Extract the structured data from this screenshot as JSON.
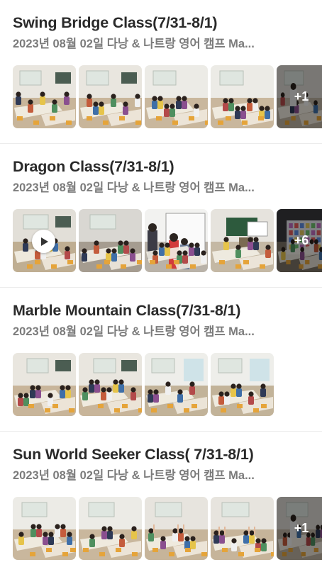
{
  "posts": [
    {
      "title": "Swing Bridge Class(7/31-8/1)",
      "subtitle": "2023년 08월 02일 다낭 & 나트랑 영어 캠프 Ma...",
      "photos": [
        {
          "scene": "classroom-tables",
          "overlay": ""
        },
        {
          "scene": "classroom-tables",
          "overlay": ""
        },
        {
          "scene": "classroom-long",
          "overlay": ""
        },
        {
          "scene": "classroom-long",
          "overlay": ""
        },
        {
          "scene": "teacher-desk",
          "overlay": "+1"
        }
      ]
    },
    {
      "title": "Dragon Class(7/31-8/1)",
      "subtitle": "2023년 08월 02일 다낭 & 나트랑 영어 캠프 Ma...",
      "photos": [
        {
          "scene": "video-classroom",
          "overlay": "",
          "video": true
        },
        {
          "scene": "kids-standing",
          "overlay": ""
        },
        {
          "scene": "whiteboard-kids",
          "overlay": ""
        },
        {
          "scene": "projector-room",
          "overlay": ""
        },
        {
          "scene": "projector-screen",
          "overlay": "+6"
        }
      ]
    },
    {
      "title": "Marble Mountain Class(7/31-8/1)",
      "subtitle": "2023년 08월 02일 다낭 & 나트랑 영어 캠프 Ma...",
      "photos": [
        {
          "scene": "classroom-tables",
          "overlay": ""
        },
        {
          "scene": "classroom-tables",
          "overlay": ""
        },
        {
          "scene": "classroom-window",
          "overlay": ""
        },
        {
          "scene": "classroom-window",
          "overlay": ""
        }
      ]
    },
    {
      "title": "Sun World Seeker Class( 7/31-8/1)",
      "subtitle": "2023년 08월 02일 다낭 & 나트랑 영어 캠프 Ma...",
      "photos": [
        {
          "scene": "classroom-long",
          "overlay": ""
        },
        {
          "scene": "classroom-long",
          "overlay": ""
        },
        {
          "scene": "kids-raising",
          "overlay": ""
        },
        {
          "scene": "kids-raising",
          "overlay": ""
        },
        {
          "scene": "teacher-desk",
          "overlay": "+1"
        }
      ]
    }
  ]
}
